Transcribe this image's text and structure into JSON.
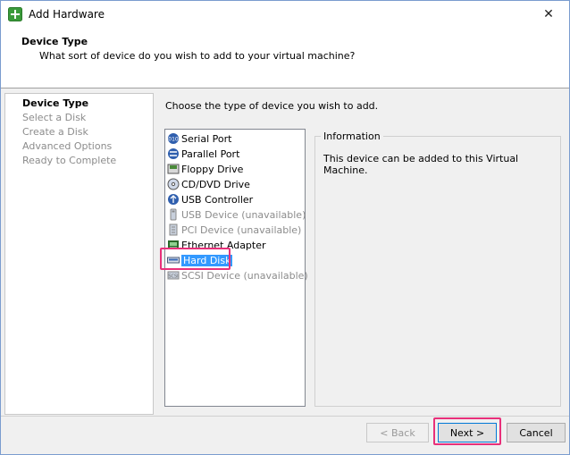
{
  "window": {
    "title": "Add Hardware",
    "close_glyph": "✕"
  },
  "header": {
    "title": "Device Type",
    "subtitle": "What sort of device do you wish to add to your virtual machine?"
  },
  "steps": [
    {
      "label": "Device Type",
      "active": true
    },
    {
      "label": "Select a Disk",
      "active": false
    },
    {
      "label": "Create a Disk",
      "active": false
    },
    {
      "label": "Advanced Options",
      "active": false
    },
    {
      "label": "Ready to Complete",
      "active": false
    }
  ],
  "content": {
    "prompt": "Choose the type of device you wish to add.",
    "devices": [
      {
        "label": "Serial Port",
        "icon": "serial-port-icon",
        "available": true
      },
      {
        "label": "Parallel Port",
        "icon": "parallel-port-icon",
        "available": true
      },
      {
        "label": "Floppy Drive",
        "icon": "floppy-drive-icon",
        "available": true
      },
      {
        "label": "CD/DVD Drive",
        "icon": "cd-dvd-drive-icon",
        "available": true
      },
      {
        "label": "USB Controller",
        "icon": "usb-controller-icon",
        "available": true
      },
      {
        "label": "USB Device (unavailable)",
        "icon": "usb-device-icon",
        "available": false
      },
      {
        "label": "PCI Device (unavailable)",
        "icon": "pci-device-icon",
        "available": false
      },
      {
        "label": "Ethernet Adapter",
        "icon": "ethernet-adapter-icon",
        "available": true
      },
      {
        "label": "Hard Disk",
        "icon": "hard-disk-icon",
        "available": true,
        "selected": true
      },
      {
        "label": "SCSI Device (unavailable)",
        "icon": "scsi-device-icon",
        "available": false
      }
    ],
    "info": {
      "legend": "Information",
      "text": "This device can be added to this Virtual Machine."
    }
  },
  "buttons": {
    "back": "< Back",
    "next": "Next >",
    "cancel": "Cancel"
  },
  "colors": {
    "selection": "#3399ff",
    "highlight": "#e8307a",
    "disabled_text": "#8c8c8c"
  }
}
